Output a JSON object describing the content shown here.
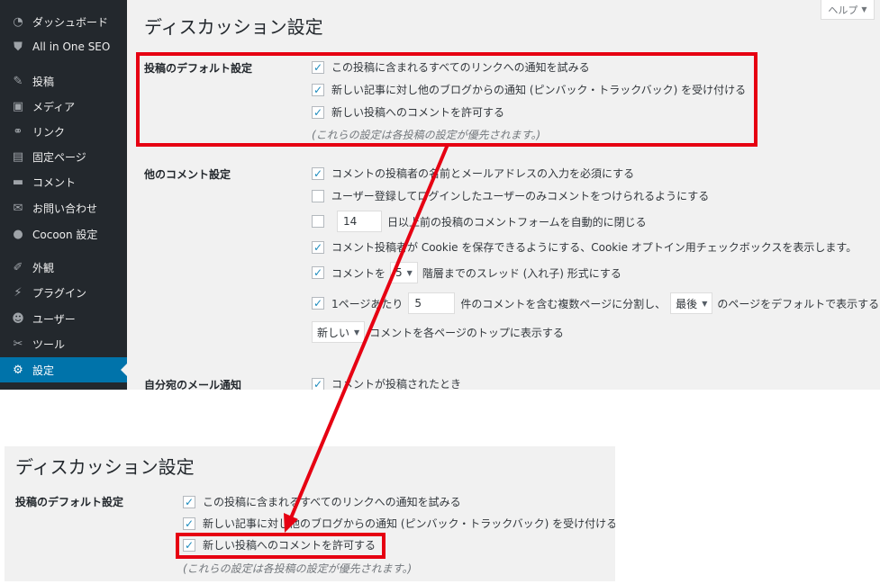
{
  "sidebar": {
    "items": [
      {
        "label": "ダッシュボード",
        "icon": "dashboard-icon",
        "glyph": "◔"
      },
      {
        "label": "All in One SEO",
        "icon": "shield-icon",
        "glyph": "⛊"
      },
      {
        "label": "投稿",
        "icon": "pin-icon",
        "glyph": "✎"
      },
      {
        "label": "メディア",
        "icon": "media-icon",
        "glyph": "▣"
      },
      {
        "label": "リンク",
        "icon": "link-icon",
        "glyph": "⚭"
      },
      {
        "label": "固定ページ",
        "icon": "page-icon",
        "glyph": "▤"
      },
      {
        "label": "コメント",
        "icon": "comment-icon",
        "glyph": "▬"
      },
      {
        "label": "お問い合わせ",
        "icon": "mail-icon",
        "glyph": "✉"
      },
      {
        "label": "Cocoon 設定",
        "icon": "circle-icon",
        "glyph": "●"
      },
      {
        "label": "外観",
        "icon": "appearance-icon",
        "glyph": "✐"
      },
      {
        "label": "プラグイン",
        "icon": "plugin-icon",
        "glyph": "⚡"
      },
      {
        "label": "ユーザー",
        "icon": "user-icon",
        "glyph": "☻"
      },
      {
        "label": "ツール",
        "icon": "wrench-icon",
        "glyph": "✂"
      },
      {
        "label": "設定",
        "icon": "settings-icon",
        "glyph": "⚙"
      }
    ],
    "active": "設定"
  },
  "header": {
    "title": "ディスカッション設定",
    "help_label": "ヘルプ",
    "help_chevron": "▼"
  },
  "default_article_settings": {
    "label": "投稿のデフォルト設定",
    "options": [
      {
        "text": "この投稿に含まれるすべてのリンクへの通知を試みる",
        "checked": true
      },
      {
        "text": "新しい記事に対し他のブログからの通知 (ピンバック・トラックバック) を受け付ける",
        "checked": true
      },
      {
        "text": "新しい投稿へのコメントを許可する",
        "checked": true
      }
    ],
    "note": "(これらの設定は各投稿の設定が優先されます。)"
  },
  "other_comment_settings": {
    "label": "他のコメント設定",
    "require_name_email": "コメントの投稿者の名前とメールアドレスの入力を必須にする",
    "registered_only": "ユーザー登録してログインしたユーザーのみコメントをつけられるようにする",
    "close_days_value": "14",
    "close_days_text": "日以上前の投稿のコメントフォームを自動的に閉じる",
    "cookies_text": "コメント投稿者が Cookie を保存できるようにする、Cookie オプトイン用チェックボックスを表示します。",
    "thread_prefix": "コメントを",
    "thread_depth": "5",
    "thread_suffix": "階層までのスレッド (入れ子) 形式にする",
    "paged_prefix": "1ページあたり",
    "paged_value": "5",
    "paged_middle": "件のコメントを含む複数ページに分割し、",
    "paged_select": "最後",
    "paged_suffix": "のページをデフォルトで表示する",
    "order_select": "新しい",
    "order_suffix": "コメントを各ページのトップに表示する"
  },
  "email_me": {
    "label": "自分宛のメール通知",
    "option": "コメントが投稿されたとき"
  },
  "colors": {
    "sidebar_bg": "#23282d",
    "active_bg": "#0073aa",
    "highlight": "#e60012",
    "page_bg": "#f1f1f1"
  }
}
